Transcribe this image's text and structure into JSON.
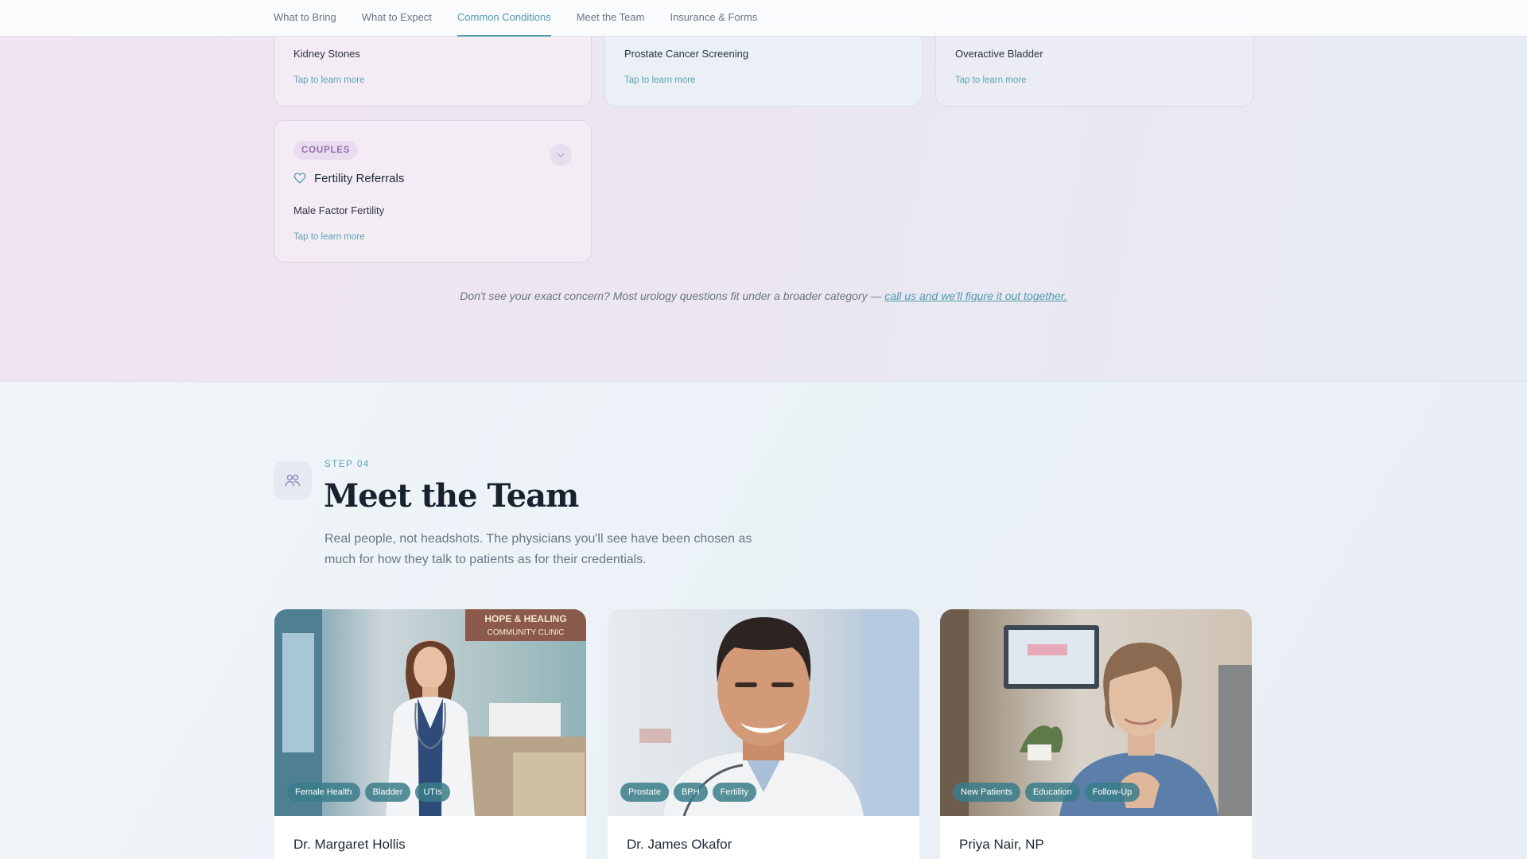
{
  "nav": {
    "items": [
      {
        "label": "What to Bring",
        "active": false
      },
      {
        "label": "What to Expect",
        "active": false
      },
      {
        "label": "Common Conditions",
        "active": true
      },
      {
        "label": "Meet the Team",
        "active": false
      },
      {
        "label": "Insurance & Forms",
        "active": false
      }
    ]
  },
  "conditions": {
    "cards_top": [
      {
        "condition": "Kidney Stones",
        "link": "Tap to learn more"
      },
      {
        "condition": "Prostate Cancer Screening",
        "link": "Tap to learn more"
      },
      {
        "condition": "Overactive Bladder",
        "link": "Tap to learn more"
      }
    ],
    "couples_card": {
      "badge": "COUPLES",
      "title": "Fertility Referrals",
      "condition": "Male Factor Fertility",
      "link": "Tap to learn more"
    },
    "note_text": "Don't see your exact concern? Most urology questions fit under a broader category — ",
    "note_link": "call us and we'll figure it out together."
  },
  "team": {
    "step": "STEP 04",
    "title": "Meet the Team",
    "description": "Real people, not headshots. The physicians you'll see have been chosen as much for how they talk to patients as for their credentials.",
    "members": [
      {
        "name": "Dr. Margaret Hollis",
        "tags": [
          "Female Health",
          "Bladder",
          "UTIs"
        ],
        "sign_text": "HOPE & HEALING COMMUNITY CLINIC"
      },
      {
        "name": "Dr. James Okafor",
        "tags": [
          "Prostate",
          "BPH",
          "Fertility"
        ]
      },
      {
        "name": "Priya Nair, NP",
        "tags": [
          "New Patients",
          "Education",
          "Follow-Up"
        ]
      }
    ]
  },
  "colors": {
    "accent": "#4f9dab",
    "tag_bg": "#3a7c8a",
    "badge_text": "#9a6fb0",
    "heading": "#18222e"
  }
}
